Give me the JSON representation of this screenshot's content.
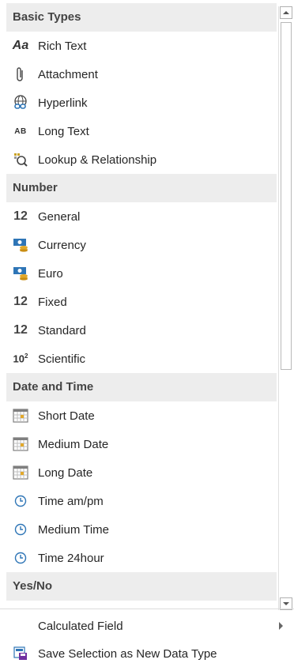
{
  "sections": [
    {
      "header": "Basic Types",
      "items": [
        {
          "name": "rich-text",
          "label": "Rich Text",
          "icon": "aa-icon"
        },
        {
          "name": "attachment",
          "label": "Attachment",
          "icon": "paperclip-icon"
        },
        {
          "name": "hyperlink",
          "label": "Hyperlink",
          "icon": "globe-link-icon"
        },
        {
          "name": "long-text",
          "label": "Long Text",
          "icon": "ab-icon"
        },
        {
          "name": "lookup-relationship",
          "label": "Lookup & Relationship",
          "icon": "lookup-icon"
        }
      ]
    },
    {
      "header": "Number",
      "items": [
        {
          "name": "general",
          "label": "General",
          "icon": "number-icon",
          "icon_text": "12"
        },
        {
          "name": "currency",
          "label": "Currency",
          "icon": "currency-icon"
        },
        {
          "name": "euro",
          "label": "Euro",
          "icon": "currency-icon"
        },
        {
          "name": "fixed",
          "label": "Fixed",
          "icon": "number-icon",
          "icon_text": "12"
        },
        {
          "name": "standard",
          "label": "Standard",
          "icon": "number-icon",
          "icon_text": "12"
        },
        {
          "name": "scientific",
          "label": "Scientific",
          "icon": "scientific-icon",
          "icon_text": "10",
          "icon_sup": "2"
        }
      ]
    },
    {
      "header": "Date and Time",
      "items": [
        {
          "name": "short-date",
          "label": "Short Date",
          "icon": "calendar-icon"
        },
        {
          "name": "medium-date",
          "label": "Medium Date",
          "icon": "calendar-icon"
        },
        {
          "name": "long-date",
          "label": "Long Date",
          "icon": "calendar-icon"
        },
        {
          "name": "time-am-pm",
          "label": "Time am/pm",
          "icon": "clock-icon"
        },
        {
          "name": "medium-time",
          "label": "Medium Time",
          "icon": "clock-icon"
        },
        {
          "name": "time-24hour",
          "label": "Time 24hour",
          "icon": "clock-icon"
        }
      ]
    },
    {
      "header": "Yes/No",
      "items": []
    }
  ],
  "bottom": {
    "calculated_field": "Calculated Field",
    "save_selection": "Save Selection as New Data Type"
  },
  "colors": {
    "header_bg": "#ededed",
    "accent_blue": "#2e75b6",
    "currency_gold": "#e2a82a"
  }
}
